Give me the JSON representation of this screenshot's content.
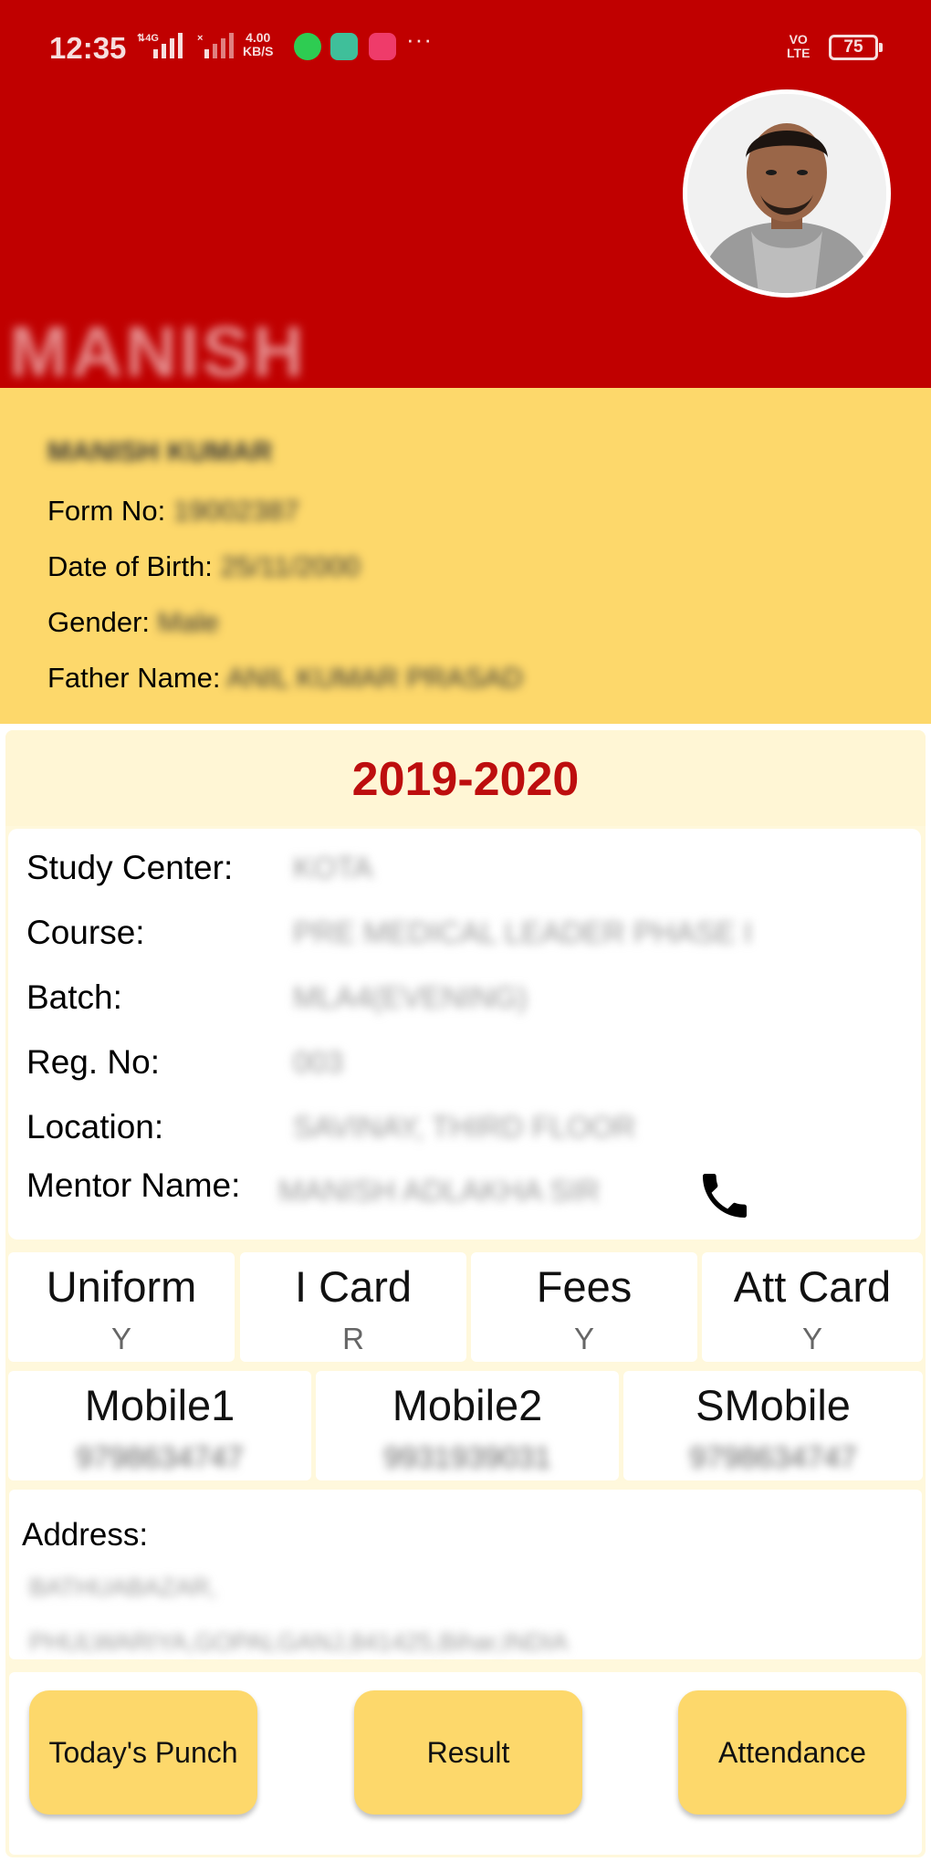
{
  "status_bar": {
    "time": "12:35",
    "network": "4G",
    "speed_value": "4.00",
    "speed_unit": "KB/S",
    "more": "···",
    "volte_top": "VO",
    "volte_bottom": "LTE",
    "battery": "75",
    "apps": [
      "whatsapp-icon",
      "app-icon-green",
      "app-icon-pink"
    ]
  },
  "header": {
    "blurred_title": "MANISH"
  },
  "profile": {
    "name": "MANISH KUMAR",
    "form_no_label": "Form No:",
    "form_no_value": "19002387",
    "dob_label": "Date of Birth:",
    "dob_value": "25/11/2000",
    "gender_label": "Gender:",
    "gender_value": "Male",
    "father_label": "Father Name:",
    "father_value": "ANIL KUMAR PRASAD"
  },
  "session": {
    "year": "2019-2020"
  },
  "details": {
    "study_center_label": "Study Center:",
    "study_center_value": "KOTA",
    "course_label": "Course:",
    "course_value": "PRE MEDICAL LEADER PHASE I",
    "batch_label": "Batch:",
    "batch_value": "MLA4(EVENING)",
    "reg_label": "Reg. No:",
    "reg_value": "003",
    "location_label": "Location:",
    "location_value": "SAVINAY, THIRD FLOOR",
    "mentor_label": "Mentor Name:",
    "mentor_value": "MANISH ADLAKHA SIR"
  },
  "status_tiles": [
    {
      "title": "Uniform",
      "value": "Y"
    },
    {
      "title": "I Card",
      "value": "R"
    },
    {
      "title": "Fees",
      "value": "Y"
    },
    {
      "title": "Att Card",
      "value": "Y"
    }
  ],
  "mobile_tiles": [
    {
      "title": "Mobile1",
      "value": "9798634747"
    },
    {
      "title": "Mobile2",
      "value": "9931939031"
    },
    {
      "title": "SMobile",
      "value": "9798634747"
    }
  ],
  "address": {
    "label": "Address:",
    "line1": "BATHUABAZAR,",
    "line2": "PHULWARIYA,GOPALGANJ,841425,Bihar,INDIA"
  },
  "actions": {
    "punch": "Today's Punch",
    "result": "Result",
    "attendance": "Attendance"
  },
  "colors": {
    "header_red": "#c00000",
    "profile_yellow": "#fdd86b",
    "year_red": "#bd0e0e",
    "card_cream": "#fff8dc"
  }
}
